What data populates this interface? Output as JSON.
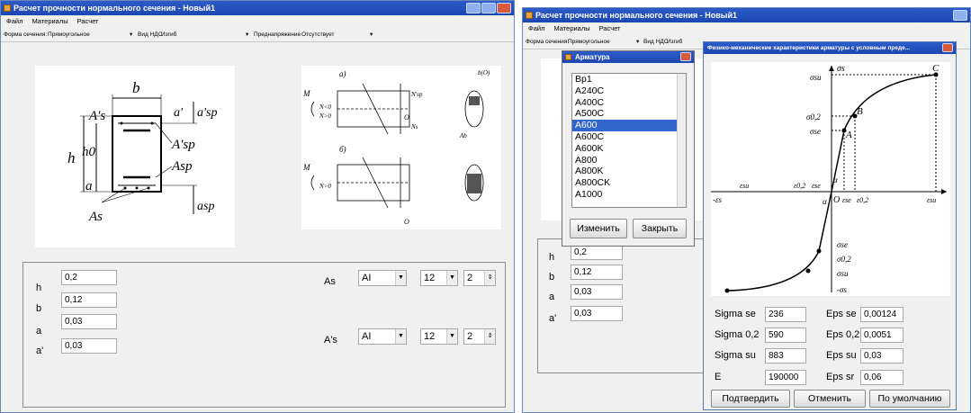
{
  "left_window": {
    "title": "Расчет прочности нормального сечения - Новый1",
    "menu": [
      "Файл",
      "Материалы",
      "Расчет"
    ],
    "toolbar": {
      "shape_label": "Форма сечения:",
      "shape_value": "Прямоугольное",
      "ndc_label": "Вид НДС",
      "ndc_value": "Изгиб",
      "prestress_label": "Преднапряжение",
      "prestress_value": "Отсутствует"
    },
    "diagram_labels": {
      "h": "h",
      "h0": "h0",
      "a": "a",
      "b": "b",
      "As": "As",
      "As_p": "A's",
      "Asp": "Asp",
      "Asp_p": "A'sp",
      "a_p": "a'",
      "asp": "asp",
      "a_sp_p": "a'sp"
    },
    "fig_labels": {
      "a": "а)",
      "b": "б)",
      "M": "M",
      "N_lt": "N<0",
      "N_gt": "N>0",
      "O": "O",
      "Ns": "Ns",
      "Nsp": "N'sp",
      "bO": "b(O)",
      "Ab": "Ab"
    },
    "fields": [
      {
        "label": "h",
        "value": "0,2"
      },
      {
        "label": "b",
        "value": "0,12"
      },
      {
        "label": "a",
        "value": "0,03"
      },
      {
        "label": "a'",
        "value": "0,03"
      }
    ],
    "reinf": [
      {
        "label": "As",
        "class": "AI",
        "dia": "12",
        "count": "2"
      },
      {
        "label": "A's",
        "class": "AI",
        "dia": "12",
        "count": "2"
      }
    ]
  },
  "right_window": {
    "title": "Расчет прочности нормального сечения - Новый1",
    "menu": [
      "Файл",
      "Материалы",
      "Расчет"
    ],
    "toolbar": {
      "shape_label": "Форма сечения:",
      "shape_value": "Прямоугольное",
      "ndc_label": "Вид НДС",
      "ndc_value": "Изгиб"
    },
    "fields": [
      {
        "label": "h",
        "value": "0,2"
      },
      {
        "label": "b",
        "value": "0,12"
      },
      {
        "label": "a",
        "value": "0,03"
      },
      {
        "label": "a'",
        "value": "0,03"
      }
    ]
  },
  "armatura_dialog": {
    "title": "Арматура",
    "items": [
      "Bp1",
      "A240C",
      "A400C",
      "A500C",
      "A600",
      "A600C",
      "A600K",
      "A800",
      "A800K",
      "A800CK",
      "A1000"
    ],
    "selected": "A600",
    "edit_button": "Изменить",
    "close_button": "Закрыть"
  },
  "props_dialog": {
    "title": "Физико-механические характеристики арматуры с условным преде...",
    "chart_labels": {
      "sigma_s": "σs",
      "sigma_su": "σsu",
      "sigma_02": "σ0,2",
      "sigma_se": "σse",
      "eps_su": "εsu",
      "eps_02": "ε0,2",
      "eps_se": "εse",
      "eps_s": "-εs",
      "O": "O",
      "alpha": "α",
      "A": "A",
      "B": "B",
      "C": "C",
      "neg_sigma": "-σs",
      "eps_su_r": "εsu"
    },
    "params": [
      {
        "label": "Sigma se",
        "value": "236",
        "label2": "Eps se",
        "value2": "0,00124"
      },
      {
        "label": "Sigma 0,2",
        "value": "590",
        "label2": "Eps 0,2",
        "value2": "0,0051"
      },
      {
        "label": "Sigma su",
        "value": "883",
        "label2": "Eps su",
        "value2": "0,03"
      },
      {
        "label": "E",
        "value": "190000",
        "label2": "Eps sr",
        "value2": "0,06"
      }
    ],
    "buttons": {
      "confirm": "Подтвердить",
      "cancel": "Отменить",
      "default": "По умолчанию"
    }
  }
}
